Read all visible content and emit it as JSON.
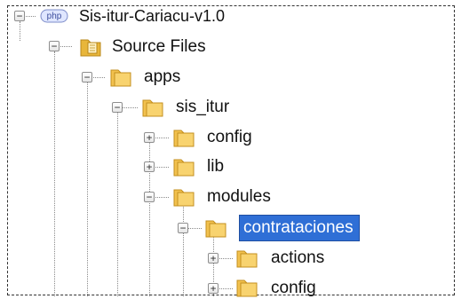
{
  "tree": {
    "root": {
      "label": "Sis-itur-Cariacu-v1.0",
      "badge": "php"
    },
    "source_files": {
      "label": "Source Files"
    },
    "apps": {
      "label": "apps"
    },
    "sis_itur": {
      "label": "sis_itur"
    },
    "config_1": {
      "label": "config"
    },
    "lib": {
      "label": "lib"
    },
    "modules": {
      "label": "modules"
    },
    "contrataciones": {
      "label": "contrataciones",
      "selected": true
    },
    "actions": {
      "label": "actions"
    },
    "config_2": {
      "label": "config"
    }
  },
  "toggles": {
    "expanded": "−",
    "collapsed": "+"
  },
  "colors": {
    "selection_bg": "#2f6fd6",
    "selection_text": "#ffffff",
    "folder_main": "#f5c24a",
    "folder_shadow": "#d29a20",
    "line": "#8a8a8a"
  },
  "icons": {
    "folder": "folder-icon",
    "source_folder": "source-folder-icon",
    "project": "php-project-icon"
  }
}
